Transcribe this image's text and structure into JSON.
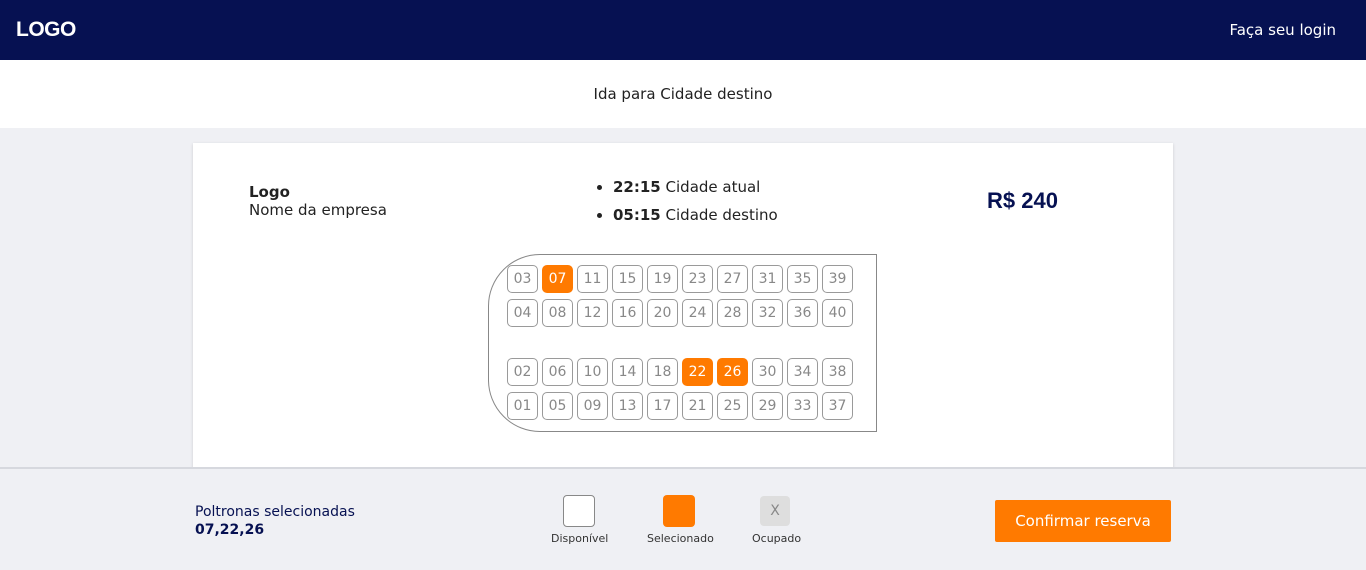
{
  "header": {
    "logo": "LOGO",
    "login_link": "Faça seu login"
  },
  "route": {
    "title": "Ida para Cidade destino"
  },
  "trip": {
    "company_logo": "Logo",
    "company_name": "Nome da empresa",
    "departure": {
      "time": "22:15",
      "city": "Cidade atual"
    },
    "arrival": {
      "time": "05:15",
      "city": "Cidade destino"
    },
    "price": "R$ 240"
  },
  "seat_map": {
    "rows": [
      [
        "03",
        "07",
        "11",
        "15",
        "19",
        "23",
        "27",
        "31",
        "35",
        "39"
      ],
      [
        "04",
        "08",
        "12",
        "16",
        "20",
        "24",
        "28",
        "32",
        "36",
        "40"
      ],
      [
        "02",
        "06",
        "10",
        "14",
        "18",
        "22",
        "26",
        "30",
        "34",
        "38"
      ],
      [
        "01",
        "05",
        "09",
        "13",
        "17",
        "21",
        "25",
        "29",
        "33",
        "37"
      ]
    ],
    "selected": [
      "07",
      "22",
      "26"
    ]
  },
  "footer": {
    "selected_label": "Poltronas selecionadas",
    "selected_value": "07,22,26",
    "legend": {
      "available": "Disponível",
      "selected": "Selecionado",
      "occupied": "Ocupado",
      "occupied_mark": "X"
    },
    "confirm_button": "Confirmar reserva"
  },
  "colors": {
    "navy": "#061152",
    "accent": "#ff7a00",
    "occupied": "#dedede"
  }
}
